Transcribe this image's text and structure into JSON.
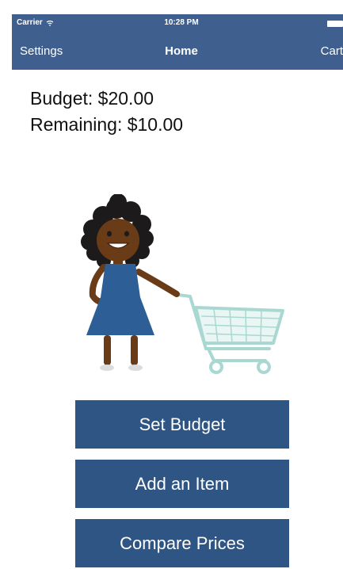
{
  "status_bar": {
    "carrier": "Carrier",
    "time": "10:28 PM",
    "wifi_icon": "wifi-icon",
    "battery_icon": "battery-icon"
  },
  "nav": {
    "left_label": "Settings",
    "title": "Home",
    "right_label": "Cart"
  },
  "budget": {
    "budget_text": "Budget: $20.00",
    "remaining_text": "Remaining: $10.00"
  },
  "illustration": {
    "name": "girl-with-shopping-cart-illustration"
  },
  "buttons": {
    "set_budget": "Set Budget",
    "add_item": "Add an Item",
    "compare_prices": "Compare Prices"
  },
  "colors": {
    "nav_background": "#3f5f8f",
    "button_background": "#2f5584",
    "button_text": "#ffffff",
    "cart_color": "#a9d8d3",
    "dress_color": "#2d5f96"
  }
}
